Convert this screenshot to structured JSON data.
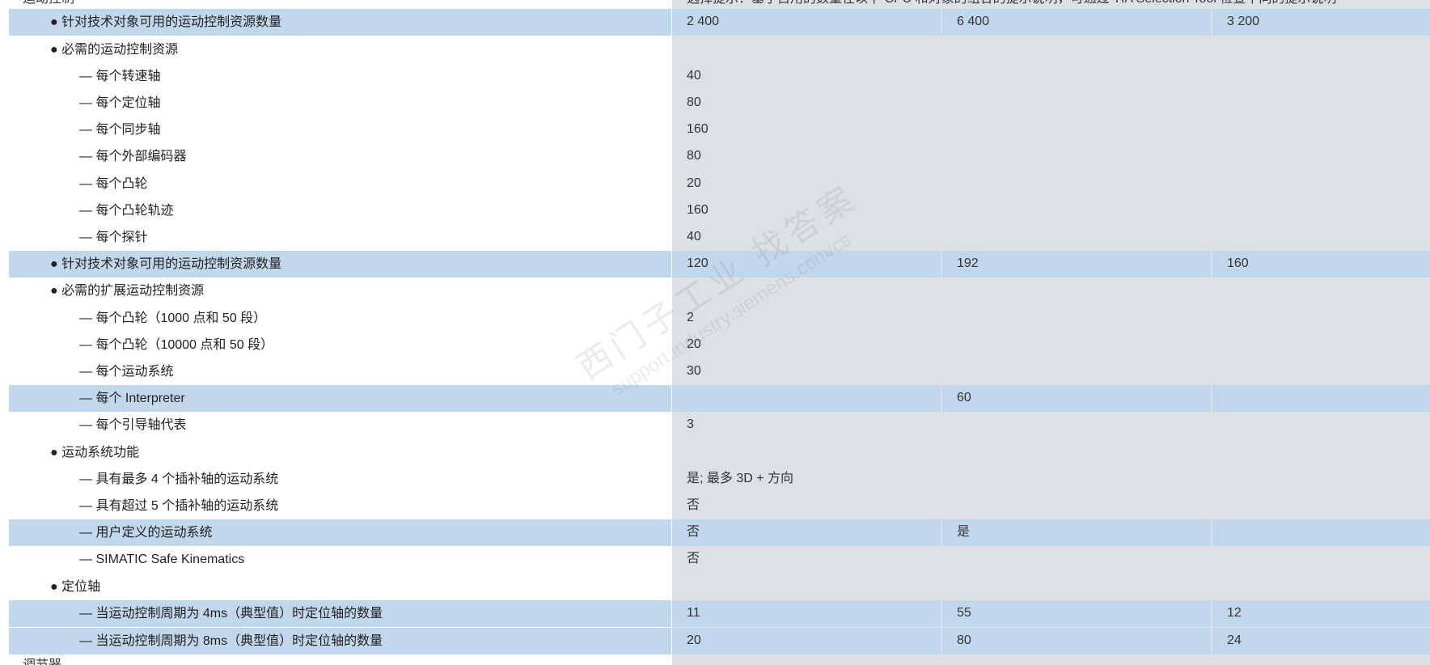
{
  "top_cut": {
    "left": "运动控制",
    "right": "选择提示：基于占用的数量在以下 CPU 和对象的组合的提示说明，可通过 TIA Selection Tool 检查不同的提示说明"
  },
  "bottom_cut": {
    "left": "调节器"
  },
  "rows": [
    {
      "label": "● 针对技术对象可用的运动控制资源数量",
      "v1": "2 400",
      "v2": "6 400",
      "v3": "3 200"
    },
    {
      "label": "● 必需的运动控制资源",
      "v1": "",
      "v2": "",
      "v3": ""
    },
    {
      "label": "— 每个转速轴",
      "v1": "40",
      "v2": "",
      "v3": ""
    },
    {
      "label": "— 每个定位轴",
      "v1": "80",
      "v2": "",
      "v3": ""
    },
    {
      "label": "— 每个同步轴",
      "v1": "160",
      "v2": "",
      "v3": ""
    },
    {
      "label": "— 每个外部编码器",
      "v1": "80",
      "v2": "",
      "v3": ""
    },
    {
      "label": "— 每个凸轮",
      "v1": "20",
      "v2": "",
      "v3": ""
    },
    {
      "label": "— 每个凸轮轨迹",
      "v1": "160",
      "v2": "",
      "v3": ""
    },
    {
      "label": "— 每个探针",
      "v1": "40",
      "v2": "",
      "v3": ""
    },
    {
      "label": "● 针对技术对象可用的运动控制资源数量",
      "v1": "120",
      "v2": "192",
      "v3": "160"
    },
    {
      "label": "● 必需的扩展运动控制资源",
      "v1": "",
      "v2": "",
      "v3": ""
    },
    {
      "label": "— 每个凸轮（1000 点和 50 段）",
      "v1": "2",
      "v2": "",
      "v3": ""
    },
    {
      "label": "— 每个凸轮（10000 点和 50 段）",
      "v1": "20",
      "v2": "",
      "v3": ""
    },
    {
      "label": "— 每个运动系统",
      "v1": "30",
      "v2": "",
      "v3": ""
    },
    {
      "label": "— 每个 Interpreter",
      "v1": "",
      "v2": "60",
      "v3": ""
    },
    {
      "label": "— 每个引导轴代表",
      "v1": "3",
      "v2": "",
      "v3": ""
    },
    {
      "label": "● 运动系统功能",
      "v1": "",
      "v2": "",
      "v3": ""
    },
    {
      "label": "— 具有最多 4 个插补轴的运动系统",
      "v1": "是; 最多 3D + 方向",
      "v2": "",
      "v3": ""
    },
    {
      "label": "— 具有超过 5 个插补轴的运动系统",
      "v1": "否",
      "v2": "",
      "v3": ""
    },
    {
      "label": "— 用户定义的运动系统",
      "v1": "否",
      "v2": "是",
      "v3": ""
    },
    {
      "label": "— SIMATIC Safe Kinematics",
      "v1": "否",
      "v2": "",
      "v3": ""
    },
    {
      "label": "● 定位轴",
      "v1": "",
      "v2": "",
      "v3": ""
    },
    {
      "label": "— 当运动控制周期为 4ms（典型值）时定位轴的数量",
      "v1": "11",
      "v2": "55",
      "v3": "12"
    },
    {
      "label": "— 当运动控制周期为 8ms（典型值）时定位轴的数量",
      "v1": "20",
      "v2": "80",
      "v3": "24"
    }
  ],
  "watermark": {
    "text": "西门子工业  找答案",
    "url": "support.industry.siemens.com/cs"
  },
  "colors": {
    "highlight_row": "#c1d7ec",
    "value_area": "#dde1e6",
    "label_area": "#ffffff"
  }
}
